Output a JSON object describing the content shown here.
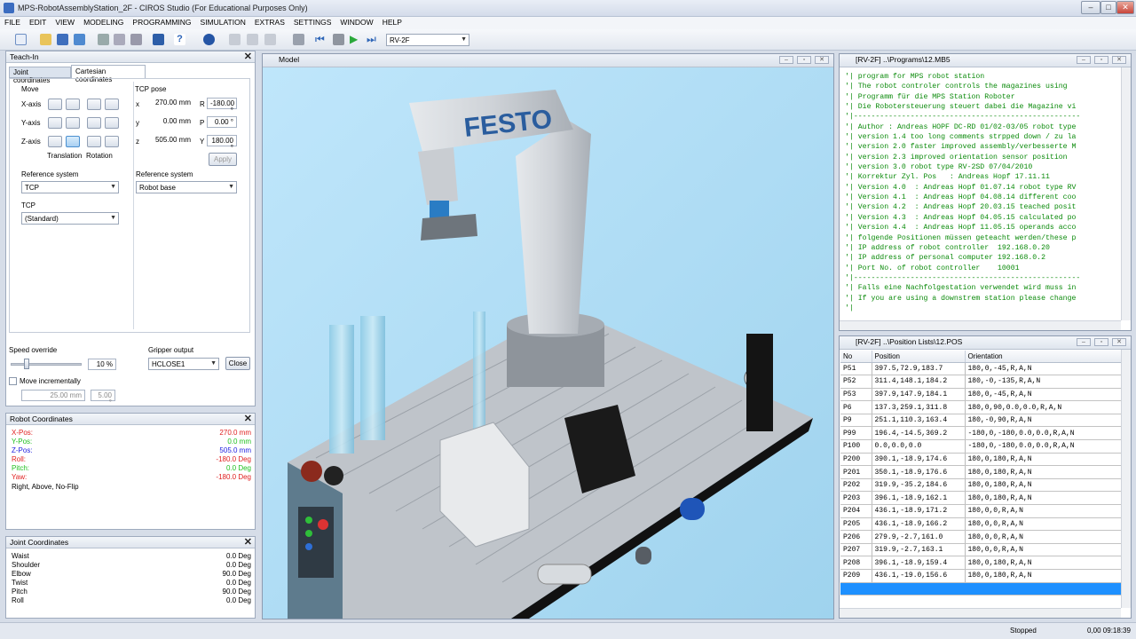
{
  "window": {
    "title": "MPS-RobotAssemblyStation_2F - CIROS Studio (For Educational Purposes Only)"
  },
  "menu": [
    "FILE",
    "EDIT",
    "VIEW",
    "MODELING",
    "PROGRAMMING",
    "SIMULATION",
    "EXTRAS",
    "SETTINGS",
    "WINDOW",
    "HELP"
  ],
  "toolbar": {
    "robot_select": "RV-2F"
  },
  "teachin": {
    "title": "Teach-In",
    "tabs": [
      "Joint coordinates",
      "Cartesian coordinates"
    ],
    "move_label": "Move",
    "axes": [
      "X-axis",
      "Y-axis",
      "Z-axis"
    ],
    "translation_label": "Translation",
    "rotation_label": "Rotation",
    "tcp_pose_label": "TCP pose",
    "pose": [
      {
        "k": "x",
        "v": "270.00 mm",
        "rk": "R",
        "rv": "-180.00 °"
      },
      {
        "k": "y",
        "v": "0.00 mm",
        "rk": "P",
        "rv": "0.00 °"
      },
      {
        "k": "z",
        "v": "505.00 mm",
        "rk": "Y",
        "rv": "180.00 °"
      }
    ],
    "apply_label": "Apply",
    "ref_sys_label": "Reference system",
    "ref_sys_value": "TCP",
    "ref_sys2_label": "Reference system",
    "ref_sys2_value": "Robot base",
    "tcp_label": "TCP",
    "tcp_value": "(Standard)",
    "speed_label": "Speed override",
    "speed_value": "10 %",
    "speed_fraction": 0.1,
    "gripper_label": "Gripper output",
    "gripper_value": "HCLOSE1",
    "close_label": "Close",
    "move_inc_label": "Move incrementally",
    "inc1": "25.00 mm",
    "inc2": "5.00 °"
  },
  "robot_coords": {
    "title": "Robot Coordinates",
    "rows": [
      {
        "k": "X-Pos:",
        "v": "270.0  mm",
        "color": "#e02020"
      },
      {
        "k": "Y-Pos:",
        "v": "0.0  mm",
        "color": "#20c020"
      },
      {
        "k": "Z-Pos:",
        "v": "505.0  mm",
        "color": "#2020e0"
      },
      {
        "k": "Roll:",
        "v": "-180.0 Deg",
        "color": "#e02020"
      },
      {
        "k": "Pitch:",
        "v": "0.0 Deg",
        "color": "#20c020"
      },
      {
        "k": "Yaw:",
        "v": "-180.0 Deg",
        "color": "#e02020"
      }
    ],
    "config": "Right, Above, No-Flip"
  },
  "joint_coords": {
    "title": "Joint Coordinates",
    "rows": [
      {
        "k": "Waist",
        "v": "0.0 Deg"
      },
      {
        "k": "Shoulder",
        "v": "0.0 Deg"
      },
      {
        "k": "Elbow",
        "v": "90.0 Deg"
      },
      {
        "k": "Twist",
        "v": "0.0 Deg"
      },
      {
        "k": "Pitch",
        "v": "90.0 Deg"
      },
      {
        "k": "Roll",
        "v": "0.0 Deg"
      }
    ]
  },
  "model": {
    "title": "Model",
    "logo": "FESTO"
  },
  "program": {
    "title": "[RV-2F] ..\\Programs\\12.MB5",
    "lines": [
      "'| program for MPS robot station",
      "'| The robot controler controls the magazines using",
      "'| Programm für die MPS Station Roboter",
      "'| Die Robotersteuerung steuert dabei die Magazine vi",
      "'|----------------------------------------------------",
      "'| Author : Andreas HOPF DC-RD 01/02-03/05 robot type",
      "'| version 1.4 too long comments strpped down / zu la",
      "'| version 2.0 faster improved assembly/verbesserte M",
      "'| version 2.3 improved orientation sensor position",
      "'| version 3.0 robot type RV-2SD 07/04/2010",
      "'| Korrektur Zyl. Pos   : Andreas Hopf 17.11.11",
      "'| Version 4.0  : Andreas Hopf 01.07.14 robot type RV",
      "'| Version 4.1  : Andreas Hopf 04.08.14 different coo",
      "'| Version 4.2  : Andreas Hopf 20.03.15 teached posit",
      "'| Version 4.3  : Andreas Hopf 04.05.15 calculated po",
      "'| Version 4.4  : Andreas Hopf 11.05.15 operands acco",
      "'| folgende Positionen müssen geteacht werden/these p",
      "'| IP address of robot controller  192.168.0.20",
      "'| IP address of personal computer 192.168.0.2",
      "'| Port No. of robot controller    10001",
      "'|----------------------------------------------------",
      "'| Falls eine Nachfolgestation verwendet wird muss in",
      "'| If you are using a downstrem station please change",
      "'|"
    ]
  },
  "poslist": {
    "title": "[RV-2F] ..\\Position Lists\\12.POS",
    "headers": [
      "No",
      "Position",
      "Orientation"
    ],
    "rows": [
      [
        "P51",
        "397.5,72.9,183.7",
        "180,0,-45,R,A,N"
      ],
      [
        "P52",
        "311.4,148.1,184.2",
        "180,-0,-135,R,A,N"
      ],
      [
        "P53",
        "397.9,147.9,184.1",
        "180,0,-45,R,A,N"
      ],
      [
        "P6",
        "137.3,259.1,311.8",
        "180,0,90,0.0,0.0,R,A,N"
      ],
      [
        "P9",
        "251.1,110.3,163.4",
        "180,-0,90,R,A,N"
      ],
      [
        "P99",
        "196.4,-14.5,369.2",
        "-180,0,-180,0.0,0.0,R,A,N"
      ],
      [
        "P100",
        "0.0,0.0,0.0",
        "-180,0,-180,0.0,0.0,R,A,N"
      ],
      [
        "P200",
        "390.1,-18.9,174.6",
        "180,0,180,R,A,N"
      ],
      [
        "P201",
        "350.1,-18.9,176.6",
        "180,0,180,R,A,N"
      ],
      [
        "P202",
        "319.9,-35.2,184.6",
        "180,0,180,R,A,N"
      ],
      [
        "P203",
        "396.1,-18.9,162.1",
        "180,0,180,R,A,N"
      ],
      [
        "P204",
        "436.1,-18.9,171.2",
        "180,0,0,R,A,N"
      ],
      [
        "P205",
        "436.1,-18.9,166.2",
        "180,0,0,R,A,N"
      ],
      [
        "P206",
        "279.9,-2.7,161.0",
        "180,0,0,R,A,N"
      ],
      [
        "P207",
        "319.9,-2.7,163.1",
        "180,0,0,R,A,N"
      ],
      [
        "P208",
        "396.1,-18.9,159.4",
        "180,0,180,R,A,N"
      ],
      [
        "P209",
        "436.1,-19.0,156.6",
        "180,0,180,R,A,N"
      ]
    ]
  },
  "status": {
    "state": "Stopped",
    "time": "0,00  09:18:39"
  }
}
